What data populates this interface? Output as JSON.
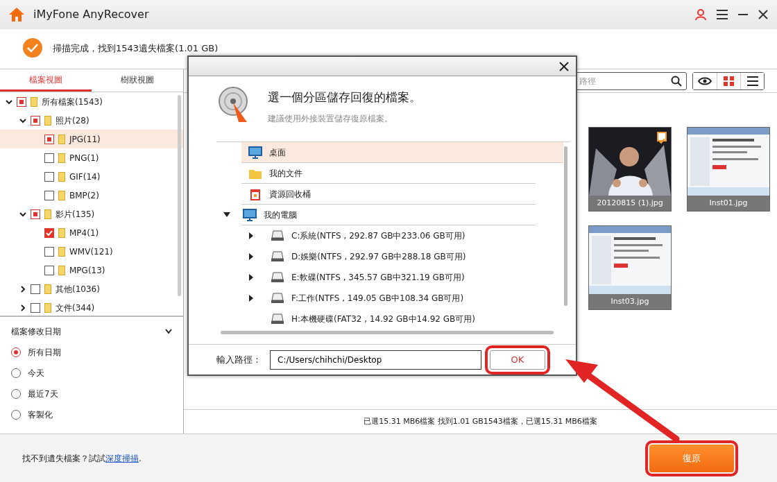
{
  "window": {
    "title": "iMyFone AnyRecover"
  },
  "scan_status": "掃描完成，找到1543遺失檔案(1.01 GB)",
  "tabs": [
    {
      "label": "檔案視圖",
      "selected": true
    },
    {
      "label": "樹狀視圖",
      "selected": false
    }
  ],
  "tree": [
    {
      "label": "所有檔案(1543)",
      "checked": false,
      "partial": true,
      "expanded": true,
      "selected": false,
      "children": [
        {
          "label": "照片(28)",
          "checked": false,
          "partial": true,
          "expanded": true,
          "selected": false,
          "children": [
            {
              "label": "JPG(11)",
              "checked": false,
              "partial": true,
              "selected": true
            },
            {
              "label": "PNG(1)",
              "checked": false,
              "partial": false,
              "selected": false
            },
            {
              "label": "GIF(14)",
              "checked": false,
              "partial": false,
              "selected": false
            },
            {
              "label": "BMP(2)",
              "checked": false,
              "partial": false,
              "selected": false
            }
          ]
        },
        {
          "label": "影片(135)",
          "checked": false,
          "partial": true,
          "expanded": true,
          "selected": false,
          "children": [
            {
              "label": "MP4(1)",
              "checked": true,
              "partial": false,
              "selected": false
            },
            {
              "label": "WMV(121)",
              "checked": false,
              "partial": false,
              "selected": false
            },
            {
              "label": "MPG(13)",
              "checked": false,
              "partial": false,
              "selected": false
            }
          ]
        },
        {
          "label": "其他(1036)",
          "checked": false,
          "partial": false,
          "expanded": false,
          "selected": false
        },
        {
          "label": "文件(344)",
          "checked": false,
          "partial": false,
          "expanded": false,
          "selected": false
        }
      ]
    }
  ],
  "date_filter": {
    "title": "檔案修改日期",
    "options": [
      {
        "label": "所有日期",
        "selected": true
      },
      {
        "label": "今天",
        "selected": false
      },
      {
        "label": "最近7天",
        "selected": false
      },
      {
        "label": "客製化",
        "selected": false
      }
    ]
  },
  "search": {
    "placeholder": "路徑"
  },
  "view_modes": [
    {
      "kind": "preview",
      "selected": false
    },
    {
      "kind": "grid",
      "selected": true
    },
    {
      "kind": "list",
      "selected": false
    }
  ],
  "files": [
    {
      "name": "20120815 (1).jpg",
      "checked": true
    },
    {
      "name": "Inst01.jpg",
      "checked": false,
      "kind": "screenshot"
    },
    {
      "name": "Inst03.jpg",
      "checked": false,
      "kind": "screenshot"
    }
  ],
  "summary": "已選15.31 MB6檔案 找到1.01 GB1543檔案，已選15.31 MB6檔案",
  "footer": {
    "hint": "找不到遺失檔案？試試",
    "link": "深度掃描",
    "after": ".",
    "button": "復原"
  },
  "dialog": {
    "title": "選一個分區儲存回復的檔案。",
    "subtitle": "建議使用外接裝置儲存復原檔案。",
    "locations": [
      {
        "kind": "desktop",
        "label": "桌面",
        "selected": true
      },
      {
        "kind": "folder",
        "label": "我的文件",
        "selected": false
      },
      {
        "kind": "recycle",
        "label": "資源回收桶",
        "selected": false
      },
      {
        "kind": "computer",
        "label": "我的電腦",
        "selected": false,
        "expanded": true,
        "children": [
          {
            "label": "C:系統(NTFS , 292.87 GB中233.06 GB可用)",
            "expandable": true
          },
          {
            "label": "D:娛樂(NTFS , 292.97 GB中288.18 GB可用)",
            "expandable": true
          },
          {
            "label": "E:軟碟(NTFS , 345.57 GB中321.19 GB可用)",
            "expandable": true
          },
          {
            "label": "F:工作(NTFS , 149.05 GB中108.34 GB可用)",
            "expandable": true
          },
          {
            "label": "H:本機硬碟(FAT32 , 14.92 GB中14.92 GB可用)",
            "expandable": false
          }
        ]
      }
    ],
    "path_label": "輸入路徑：",
    "path_value": "C:/Users/chihchi/Desktop",
    "ok": "OK"
  }
}
